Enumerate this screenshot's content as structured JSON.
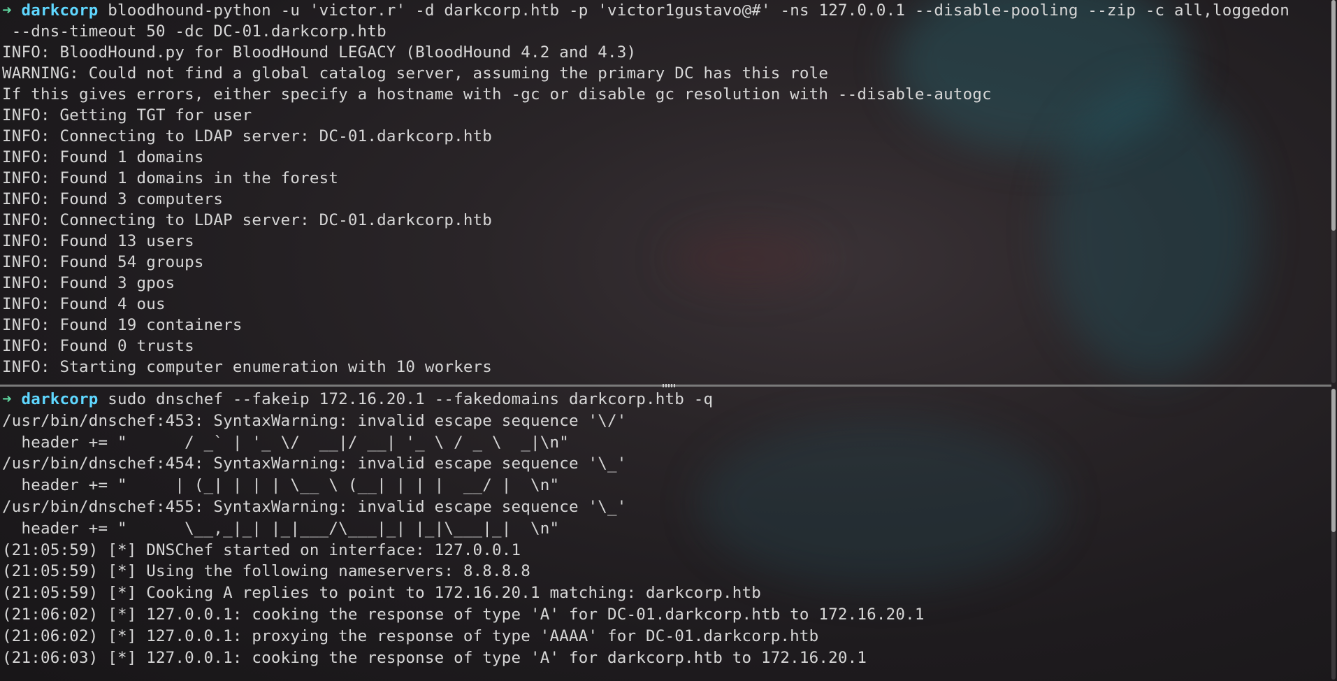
{
  "window": {
    "accent_prompt_arrow": "#5fd7a0",
    "accent_host": "#5fd7ff"
  },
  "top_pane": {
    "prompt": {
      "arrow": "➜",
      "host": "darkcorp",
      "command": " bloodhound-python -u 'victor.r' -d darkcorp.htb -p 'victor1gustavo@#' -ns 127.0.0.1 --disable-pooling --zip -c all,loggedon",
      "command_cont": " --dns-timeout 50 -dc DC-01.darkcorp.htb"
    },
    "output": [
      "INFO: BloodHound.py for BloodHound LEGACY (BloodHound 4.2 and 4.3)",
      "WARNING: Could not find a global catalog server, assuming the primary DC has this role",
      "If this gives errors, either specify a hostname with -gc or disable gc resolution with --disable-autogc",
      "INFO: Getting TGT for user",
      "INFO: Connecting to LDAP server: DC-01.darkcorp.htb",
      "INFO: Found 1 domains",
      "INFO: Found 1 domains in the forest",
      "INFO: Found 3 computers",
      "INFO: Connecting to LDAP server: DC-01.darkcorp.htb",
      "INFO: Found 13 users",
      "INFO: Found 54 groups",
      "INFO: Found 3 gpos",
      "INFO: Found 4 ous",
      "INFO: Found 19 containers",
      "INFO: Found 0 trusts",
      "INFO: Starting computer enumeration with 10 workers"
    ]
  },
  "bottom_pane": {
    "prompt": {
      "arrow": "➜",
      "host": "darkcorp",
      "command": " sudo dnschef --fakeip 172.16.20.1 --fakedomains darkcorp.htb -q"
    },
    "output": [
      "/usr/bin/dnschef:453: SyntaxWarning: invalid escape sequence '\\/'",
      "  header += \"      / _` | '_ \\/  __|/ __| '_ \\ / _ \\  _|\\n\"",
      "/usr/bin/dnschef:454: SyntaxWarning: invalid escape sequence '\\_'",
      "  header += \"     | (_| | | | \\__ \\ (__| | | |  __/ |  \\n\"",
      "/usr/bin/dnschef:455: SyntaxWarning: invalid escape sequence '\\_'",
      "  header += \"      \\__,_|_| |_|___/\\___|_| |_|\\___|_|  \\n\"",
      "(21:05:59) [*] DNSChef started on interface: 127.0.0.1",
      "(21:05:59) [*] Using the following nameservers: 8.8.8.8",
      "(21:05:59) [*] Cooking A replies to point to 172.16.20.1 matching: darkcorp.htb",
      "(21:06:02) [*] 127.0.0.1: cooking the response of type 'A' for DC-01.darkcorp.htb to 172.16.20.1",
      "(21:06:02) [*] 127.0.0.1: proxying the response of type 'AAAA' for DC-01.darkcorp.htb",
      "(21:06:03) [*] 127.0.0.1: cooking the response of type 'A' for darkcorp.htb to 172.16.20.1"
    ]
  }
}
